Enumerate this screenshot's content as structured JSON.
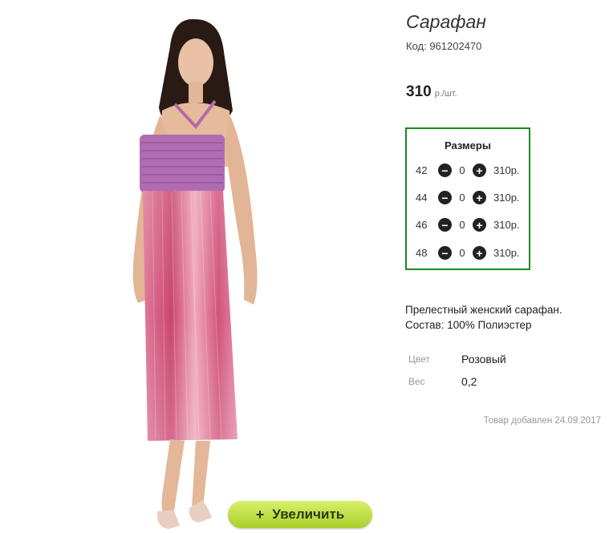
{
  "product": {
    "title": "Сарафан",
    "code_label": "Код: 961202470",
    "price": "310",
    "price_unit": "р./шт."
  },
  "sizes": {
    "title": "Размеры",
    "rows": [
      {
        "size": "42",
        "qty": "0",
        "price": "310р."
      },
      {
        "size": "44",
        "qty": "0",
        "price": "310р."
      },
      {
        "size": "46",
        "qty": "0",
        "price": "310р."
      },
      {
        "size": "48",
        "qty": "0",
        "price": "310р."
      }
    ]
  },
  "description": {
    "line1": "Прелестный женский сарафан.",
    "line2": "Состав: 100% Полиэстер"
  },
  "attributes": [
    {
      "label": "Цвет",
      "value": "Розовый"
    },
    {
      "label": "Вес",
      "value": "0,2"
    }
  ],
  "added_text": "Товар добавлен 24.09.2017",
  "zoom_button": {
    "icon": "+",
    "label": "Увеличить"
  },
  "colors": {
    "accent_border": "#1d8a1d",
    "button_green": "#b8dc3a",
    "dress_pink": "#d9577f"
  }
}
